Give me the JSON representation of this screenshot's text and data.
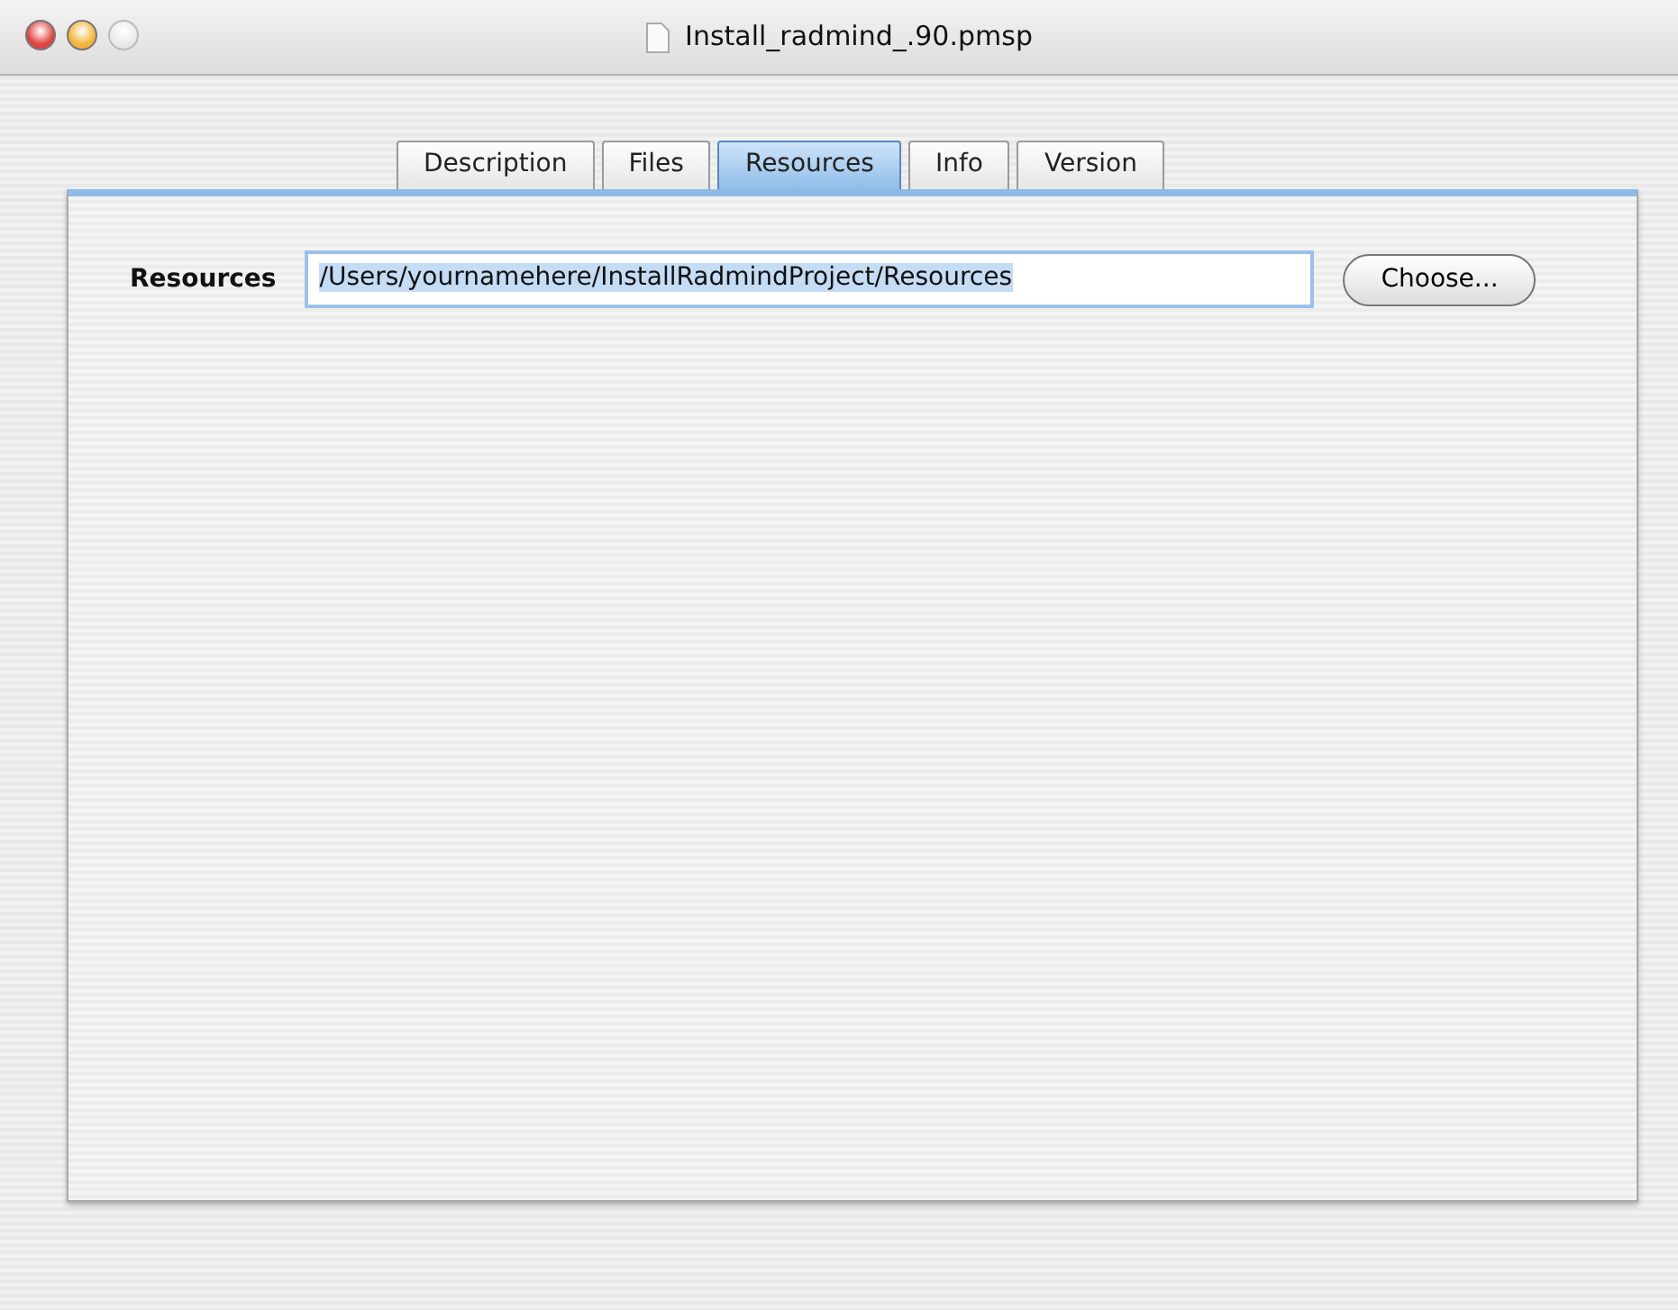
{
  "window": {
    "title": "Install_radmind_.90.pmsp",
    "buttons": [
      {
        "kind": "close",
        "disabled": false
      },
      {
        "kind": "minimize",
        "disabled": false
      },
      {
        "kind": "zoom",
        "disabled": true
      }
    ]
  },
  "tabs": [
    {
      "label": "Description",
      "selected": false
    },
    {
      "label": "Files",
      "selected": false
    },
    {
      "label": "Resources",
      "selected": true
    },
    {
      "label": "Info",
      "selected": false
    },
    {
      "label": "Version",
      "selected": false
    }
  ],
  "resources": {
    "label": "Resources",
    "value": "/Users/yournamehere/InstallRadmindProject/Resources",
    "text_selected": true,
    "button": "Choose..."
  }
}
